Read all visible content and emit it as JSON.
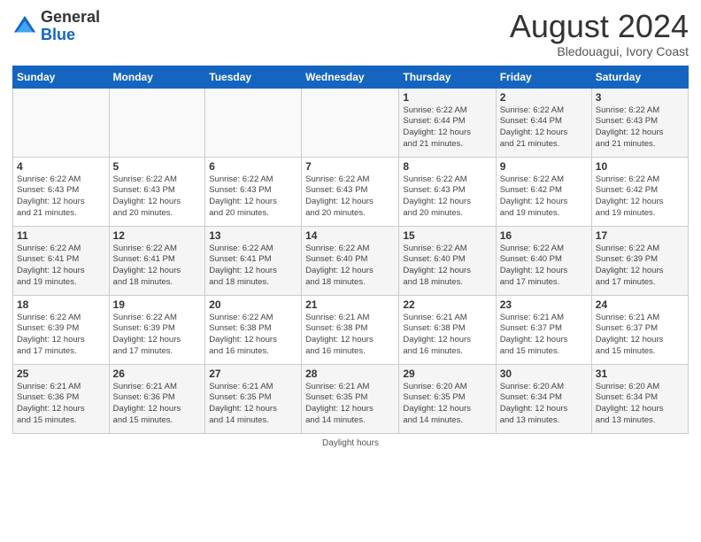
{
  "logo": {
    "line1": "General",
    "line2": "Blue"
  },
  "header": {
    "month": "August 2024",
    "location": "Bledouagui, Ivory Coast"
  },
  "weekdays": [
    "Sunday",
    "Monday",
    "Tuesday",
    "Wednesday",
    "Thursday",
    "Friday",
    "Saturday"
  ],
  "weeks": [
    [
      {
        "day": "",
        "detail": ""
      },
      {
        "day": "",
        "detail": ""
      },
      {
        "day": "",
        "detail": ""
      },
      {
        "day": "",
        "detail": ""
      },
      {
        "day": "1",
        "detail": "Sunrise: 6:22 AM\nSunset: 6:44 PM\nDaylight: 12 hours\nand 21 minutes."
      },
      {
        "day": "2",
        "detail": "Sunrise: 6:22 AM\nSunset: 6:44 PM\nDaylight: 12 hours\nand 21 minutes."
      },
      {
        "day": "3",
        "detail": "Sunrise: 6:22 AM\nSunset: 6:43 PM\nDaylight: 12 hours\nand 21 minutes."
      }
    ],
    [
      {
        "day": "4",
        "detail": "Sunrise: 6:22 AM\nSunset: 6:43 PM\nDaylight: 12 hours\nand 21 minutes."
      },
      {
        "day": "5",
        "detail": "Sunrise: 6:22 AM\nSunset: 6:43 PM\nDaylight: 12 hours\nand 20 minutes."
      },
      {
        "day": "6",
        "detail": "Sunrise: 6:22 AM\nSunset: 6:43 PM\nDaylight: 12 hours\nand 20 minutes."
      },
      {
        "day": "7",
        "detail": "Sunrise: 6:22 AM\nSunset: 6:43 PM\nDaylight: 12 hours\nand 20 minutes."
      },
      {
        "day": "8",
        "detail": "Sunrise: 6:22 AM\nSunset: 6:43 PM\nDaylight: 12 hours\nand 20 minutes."
      },
      {
        "day": "9",
        "detail": "Sunrise: 6:22 AM\nSunset: 6:42 PM\nDaylight: 12 hours\nand 19 minutes."
      },
      {
        "day": "10",
        "detail": "Sunrise: 6:22 AM\nSunset: 6:42 PM\nDaylight: 12 hours\nand 19 minutes."
      }
    ],
    [
      {
        "day": "11",
        "detail": "Sunrise: 6:22 AM\nSunset: 6:41 PM\nDaylight: 12 hours\nand 19 minutes."
      },
      {
        "day": "12",
        "detail": "Sunrise: 6:22 AM\nSunset: 6:41 PM\nDaylight: 12 hours\nand 18 minutes."
      },
      {
        "day": "13",
        "detail": "Sunrise: 6:22 AM\nSunset: 6:41 PM\nDaylight: 12 hours\nand 18 minutes."
      },
      {
        "day": "14",
        "detail": "Sunrise: 6:22 AM\nSunset: 6:40 PM\nDaylight: 12 hours\nand 18 minutes."
      },
      {
        "day": "15",
        "detail": "Sunrise: 6:22 AM\nSunset: 6:40 PM\nDaylight: 12 hours\nand 18 minutes."
      },
      {
        "day": "16",
        "detail": "Sunrise: 6:22 AM\nSunset: 6:40 PM\nDaylight: 12 hours\nand 17 minutes."
      },
      {
        "day": "17",
        "detail": "Sunrise: 6:22 AM\nSunset: 6:39 PM\nDaylight: 12 hours\nand 17 minutes."
      }
    ],
    [
      {
        "day": "18",
        "detail": "Sunrise: 6:22 AM\nSunset: 6:39 PM\nDaylight: 12 hours\nand 17 minutes."
      },
      {
        "day": "19",
        "detail": "Sunrise: 6:22 AM\nSunset: 6:39 PM\nDaylight: 12 hours\nand 17 minutes."
      },
      {
        "day": "20",
        "detail": "Sunrise: 6:22 AM\nSunset: 6:38 PM\nDaylight: 12 hours\nand 16 minutes."
      },
      {
        "day": "21",
        "detail": "Sunrise: 6:21 AM\nSunset: 6:38 PM\nDaylight: 12 hours\nand 16 minutes."
      },
      {
        "day": "22",
        "detail": "Sunrise: 6:21 AM\nSunset: 6:38 PM\nDaylight: 12 hours\nand 16 minutes."
      },
      {
        "day": "23",
        "detail": "Sunrise: 6:21 AM\nSunset: 6:37 PM\nDaylight: 12 hours\nand 15 minutes."
      },
      {
        "day": "24",
        "detail": "Sunrise: 6:21 AM\nSunset: 6:37 PM\nDaylight: 12 hours\nand 15 minutes."
      }
    ],
    [
      {
        "day": "25",
        "detail": "Sunrise: 6:21 AM\nSunset: 6:36 PM\nDaylight: 12 hours\nand 15 minutes."
      },
      {
        "day": "26",
        "detail": "Sunrise: 6:21 AM\nSunset: 6:36 PM\nDaylight: 12 hours\nand 15 minutes."
      },
      {
        "day": "27",
        "detail": "Sunrise: 6:21 AM\nSunset: 6:35 PM\nDaylight: 12 hours\nand 14 minutes."
      },
      {
        "day": "28",
        "detail": "Sunrise: 6:21 AM\nSunset: 6:35 PM\nDaylight: 12 hours\nand 14 minutes."
      },
      {
        "day": "29",
        "detail": "Sunrise: 6:20 AM\nSunset: 6:35 PM\nDaylight: 12 hours\nand 14 minutes."
      },
      {
        "day": "30",
        "detail": "Sunrise: 6:20 AM\nSunset: 6:34 PM\nDaylight: 12 hours\nand 13 minutes."
      },
      {
        "day": "31",
        "detail": "Sunrise: 6:20 AM\nSunset: 6:34 PM\nDaylight: 12 hours\nand 13 minutes."
      }
    ]
  ],
  "footer": {
    "daylight_label": "Daylight hours"
  }
}
